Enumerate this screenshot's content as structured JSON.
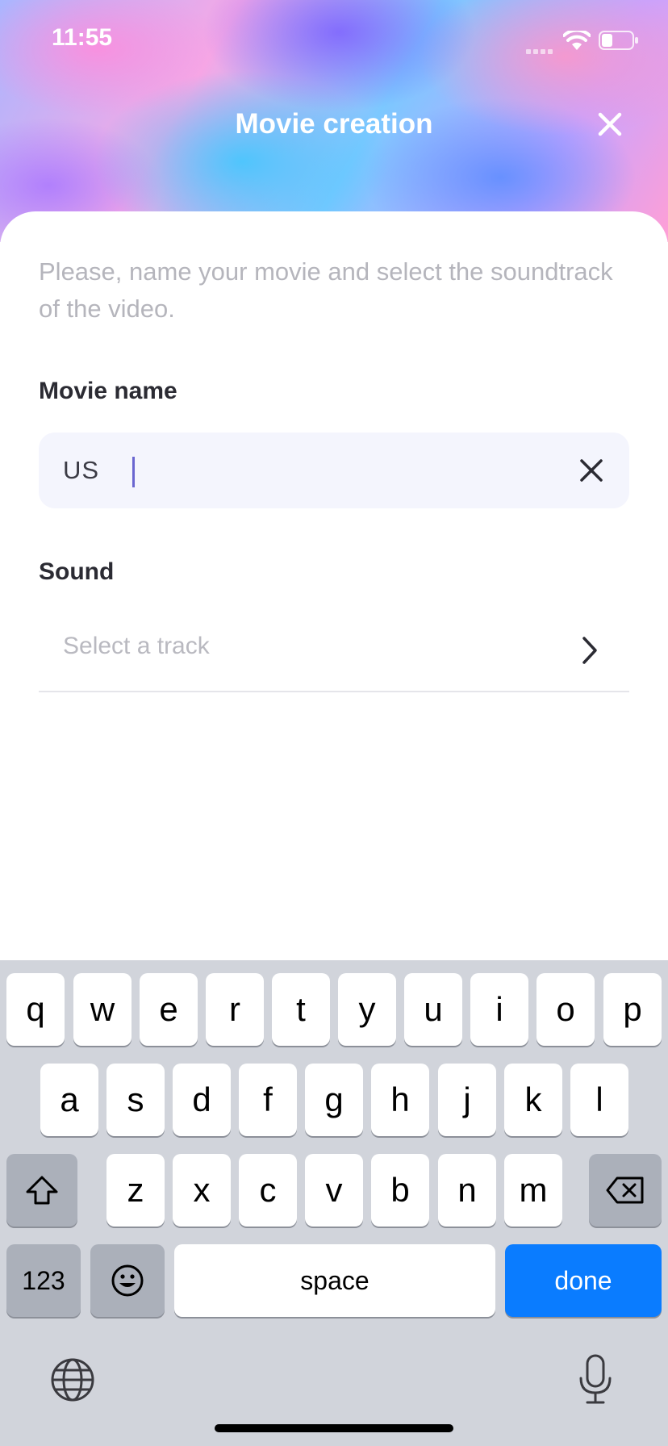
{
  "status_bar": {
    "time": "11:55"
  },
  "header": {
    "title": "Movie creation"
  },
  "form": {
    "description": "Please, name your movie and select the soundtrack of the video.",
    "movie_name_label": "Movie name",
    "movie_name_value": "US",
    "sound_label": "Sound",
    "track_placeholder": "Select a track"
  },
  "keyboard": {
    "row1": [
      "q",
      "w",
      "e",
      "r",
      "t",
      "y",
      "u",
      "i",
      "o",
      "p"
    ],
    "row2": [
      "a",
      "s",
      "d",
      "f",
      "g",
      "h",
      "j",
      "k",
      "l"
    ],
    "row3": [
      "z",
      "x",
      "c",
      "v",
      "b",
      "n",
      "m"
    ],
    "numbers_label": "123",
    "space_label": "space",
    "done_label": "done"
  },
  "colors": {
    "accent": "#0a7cff",
    "field_bg": "#f4f5fd",
    "keyboard_bg": "#d1d4db"
  }
}
